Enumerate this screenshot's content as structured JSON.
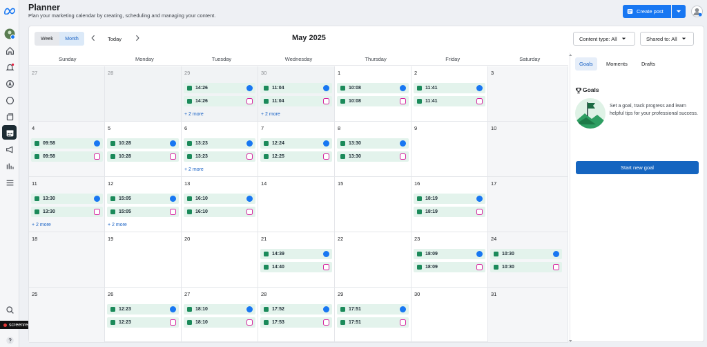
{
  "app": {
    "brand_icon": "meta-logo-icon"
  },
  "header": {
    "title": "Planner",
    "subtitle": "Plan your marketing calendar by creating, scheduling and managing your content.",
    "create_post_label": "Create post"
  },
  "toolbar": {
    "week_label": "Week",
    "month_label": "Month",
    "today_label": "Today",
    "month_title": "May 2025",
    "content_type_label": "Content type: All",
    "shared_to_label": "Shared to: All"
  },
  "weekdays": [
    "Sunday",
    "Monday",
    "Tuesday",
    "Wednesday",
    "Thursday",
    "Friday",
    "Saturday"
  ],
  "weeks": [
    [
      {
        "d": "27",
        "off": true,
        "p": []
      },
      {
        "d": "28",
        "off": true,
        "p": []
      },
      {
        "d": "29",
        "off": true,
        "p": [
          [
            "14:26",
            "facebook"
          ],
          [
            "14:26",
            "instagram"
          ]
        ],
        "more": "+ 2 more"
      },
      {
        "d": "30",
        "off": true,
        "p": [
          [
            "11:04",
            "facebook"
          ],
          [
            "11:04",
            "instagram"
          ]
        ],
        "more": "+ 2 more"
      },
      {
        "d": "1",
        "p": [
          [
            "10:08",
            "facebook"
          ],
          [
            "10:08",
            "instagram"
          ]
        ]
      },
      {
        "d": "2",
        "p": [
          [
            "11:41",
            "facebook"
          ],
          [
            "11:41",
            "instagram"
          ]
        ]
      },
      {
        "d": "3",
        "wkd": true,
        "p": []
      }
    ],
    [
      {
        "d": "4",
        "wkd": true,
        "p": [
          [
            "09:58",
            "facebook"
          ],
          [
            "09:58",
            "instagram"
          ]
        ]
      },
      {
        "d": "5",
        "p": [
          [
            "10:28",
            "facebook"
          ],
          [
            "10:28",
            "instagram"
          ]
        ]
      },
      {
        "d": "6",
        "p": [
          [
            "13:23",
            "facebook"
          ],
          [
            "13:23",
            "instagram"
          ]
        ],
        "more": "+ 2 more"
      },
      {
        "d": "7",
        "p": [
          [
            "12:24",
            "facebook"
          ],
          [
            "12:25",
            "instagram"
          ]
        ]
      },
      {
        "d": "8",
        "p": [
          [
            "13:30",
            "facebook"
          ],
          [
            "13:30",
            "instagram"
          ]
        ]
      },
      {
        "d": "9",
        "p": []
      },
      {
        "d": "10",
        "wkd": true,
        "p": []
      }
    ],
    [
      {
        "d": "11",
        "wkd": true,
        "p": [
          [
            "13:30",
            "facebook"
          ],
          [
            "13:30",
            "instagram"
          ]
        ],
        "more": "+ 2 more"
      },
      {
        "d": "12",
        "p": [
          [
            "15:05",
            "facebook"
          ],
          [
            "15:05",
            "instagram"
          ]
        ],
        "more": "+ 2 more"
      },
      {
        "d": "13",
        "p": [
          [
            "16:10",
            "facebook"
          ],
          [
            "16:10",
            "instagram"
          ]
        ]
      },
      {
        "d": "14",
        "p": []
      },
      {
        "d": "15",
        "p": []
      },
      {
        "d": "16",
        "p": [
          [
            "18:19",
            "facebook"
          ],
          [
            "18:19",
            "instagram"
          ]
        ]
      },
      {
        "d": "17",
        "wkd": true,
        "p": []
      }
    ],
    [
      {
        "d": "18",
        "wkd": true,
        "p": []
      },
      {
        "d": "19",
        "p": []
      },
      {
        "d": "20",
        "p": []
      },
      {
        "d": "21",
        "p": [
          [
            "14:39",
            "facebook"
          ],
          [
            "14:40",
            "instagram"
          ]
        ]
      },
      {
        "d": "22",
        "p": []
      },
      {
        "d": "23",
        "p": [
          [
            "18:09",
            "facebook"
          ],
          [
            "18:09",
            "instagram"
          ]
        ]
      },
      {
        "d": "24",
        "wkd": true,
        "p": [
          [
            "10:30",
            "facebook"
          ],
          [
            "10:30",
            "instagram"
          ]
        ]
      }
    ],
    [
      {
        "d": "25",
        "wkd": true,
        "p": []
      },
      {
        "d": "26",
        "p": [
          [
            "12:23",
            "facebook"
          ],
          [
            "12:23",
            "instagram"
          ]
        ]
      },
      {
        "d": "27",
        "p": [
          [
            "18:10",
            "facebook"
          ],
          [
            "18:10",
            "instagram"
          ]
        ]
      },
      {
        "d": "28",
        "p": [
          [
            "17:52",
            "facebook"
          ],
          [
            "17:53",
            "instagram"
          ]
        ]
      },
      {
        "d": "29",
        "p": [
          [
            "17:51",
            "facebook"
          ],
          [
            "17:51",
            "instagram"
          ]
        ]
      },
      {
        "d": "30",
        "p": []
      },
      {
        "d": "31",
        "wkd": true,
        "p": []
      }
    ]
  ],
  "panel": {
    "tabs": [
      "Goals",
      "Moments",
      "Drafts"
    ],
    "goals_title": "Goals",
    "goals_desc": "Set a goal, track progress and learn helpful tips for your professional success.",
    "start_goal_label": "Start new goal"
  },
  "overlay": {
    "screenrec_label": "screenrec"
  },
  "colors": {
    "primary": "#1877f2",
    "post_bg": "#e3f3ec",
    "post_icon": "#1b8a5a",
    "instagram": "#d6249f"
  }
}
